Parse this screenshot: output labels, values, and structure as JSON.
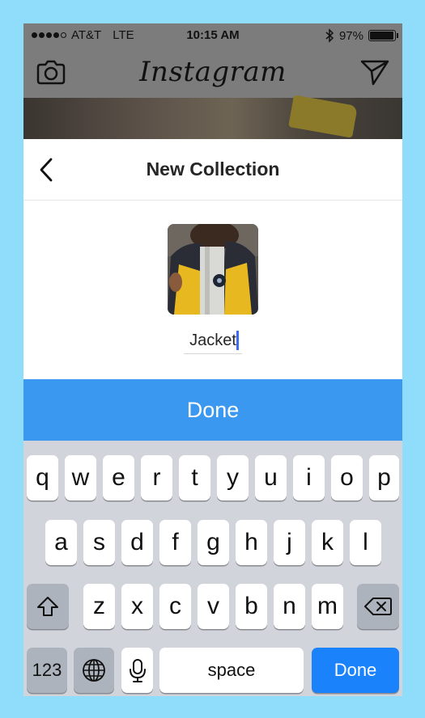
{
  "status": {
    "carrier": "AT&T",
    "network": "LTE",
    "time": "10:15 AM",
    "battery": "97%"
  },
  "app": {
    "logo": "Instagram",
    "camera_icon": "camera-icon",
    "send_icon": "paper-plane-icon"
  },
  "sheet": {
    "title": "New Collection",
    "back_icon": "chevron-left-icon"
  },
  "collection": {
    "name_value": "Jacket"
  },
  "actions": {
    "done_label": "Done"
  },
  "keyboard": {
    "row1": [
      "q",
      "w",
      "e",
      "r",
      "t",
      "y",
      "u",
      "i",
      "o",
      "p"
    ],
    "row2": [
      "a",
      "s",
      "d",
      "f",
      "g",
      "h",
      "j",
      "k",
      "l"
    ],
    "row3": [
      "z",
      "x",
      "c",
      "v",
      "b",
      "n",
      "m"
    ],
    "numbers_label": "123",
    "space_label": "space",
    "return_label": "Done"
  },
  "colors": {
    "accent": "#3b98f0",
    "keyboard_return": "#1a82fb",
    "background": "#8fdcfb"
  }
}
